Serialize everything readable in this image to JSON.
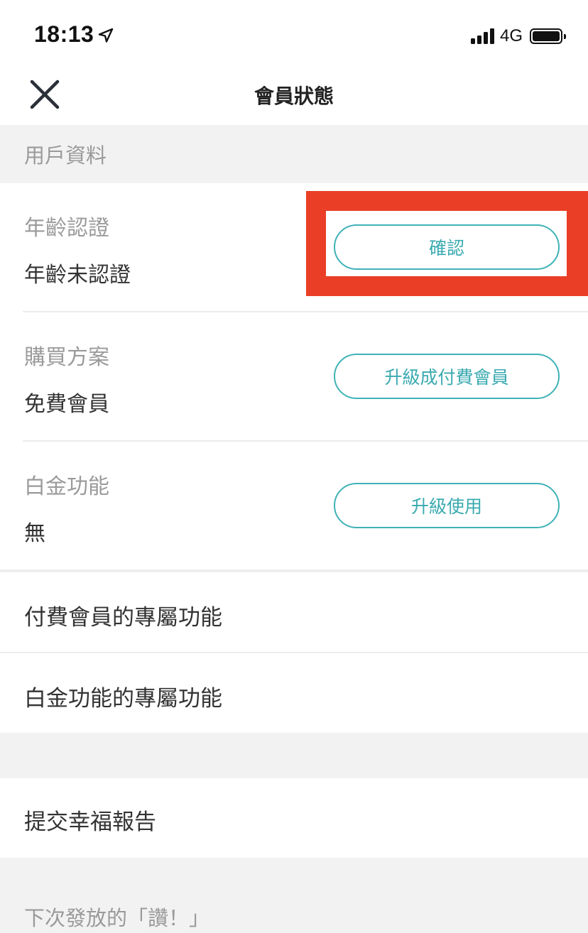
{
  "status": {
    "time": "18:13",
    "network": "4G",
    "icons": [
      "location-arrow-icon",
      "signal-icon",
      "battery-icon"
    ]
  },
  "nav": {
    "title": "會員狀態",
    "close_icon": "close-icon"
  },
  "sections": {
    "user_info_header": "用戶資料",
    "next_likes_header": "下次發放的「讚！」"
  },
  "rows": {
    "age": {
      "label": "年齡認證",
      "value": "年齡未認證",
      "button": "確認"
    },
    "plan": {
      "label": "購買方案",
      "value": "免費會員",
      "button": "升級成付費會員"
    },
    "platinum": {
      "label": "白金功能",
      "value": "無",
      "button": "升級使用"
    }
  },
  "links": {
    "paid_features": "付費會員的專屬功能",
    "platinum_features": "白金功能的專屬功能",
    "happiness_report": "提交幸福報告"
  },
  "colors": {
    "accent": "#3fb2b6",
    "highlight": "#ea3e26",
    "section_bg": "#f2f2f2"
  }
}
